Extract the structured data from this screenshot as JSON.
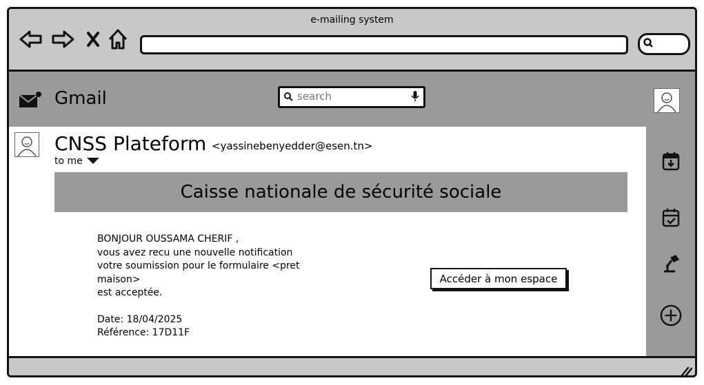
{
  "window": {
    "title": "e-mailing system"
  },
  "browser": {
    "back_icon": "back-arrow-icon",
    "forward_icon": "forward-arrow-icon",
    "stop_icon": "close-icon",
    "home_icon": "home-icon",
    "url": "",
    "search_icon": "search-icon"
  },
  "app": {
    "name": "Gmail",
    "search_placeholder": "search"
  },
  "email": {
    "sender_name": "CNSS Plateform",
    "sender_email": "<yassinebenyedder@esen.tn>",
    "recipient": "to me",
    "banner": "Caisse nationale de sécurité sociale",
    "lines": [
      "BONJOUR OUSSAMA CHERIF ,",
      "vous avez recu une nouvelle notification",
      "votre soumission pour le formulaire <pret",
      "maison>",
      "est acceptée."
    ],
    "date_line": "Date: 18/04/2025",
    "reference_line": "Référence: 17D11F",
    "cta_label": "Accéder à mon espace"
  },
  "side_icons": [
    "calendar-download-icon",
    "calendar-check-icon",
    "desk-lamp-icon",
    "add-circle-icon"
  ],
  "colors": {
    "header_bg": "#9a9a9a",
    "chrome_bg": "#c8c8c8",
    "border": "#111111"
  }
}
